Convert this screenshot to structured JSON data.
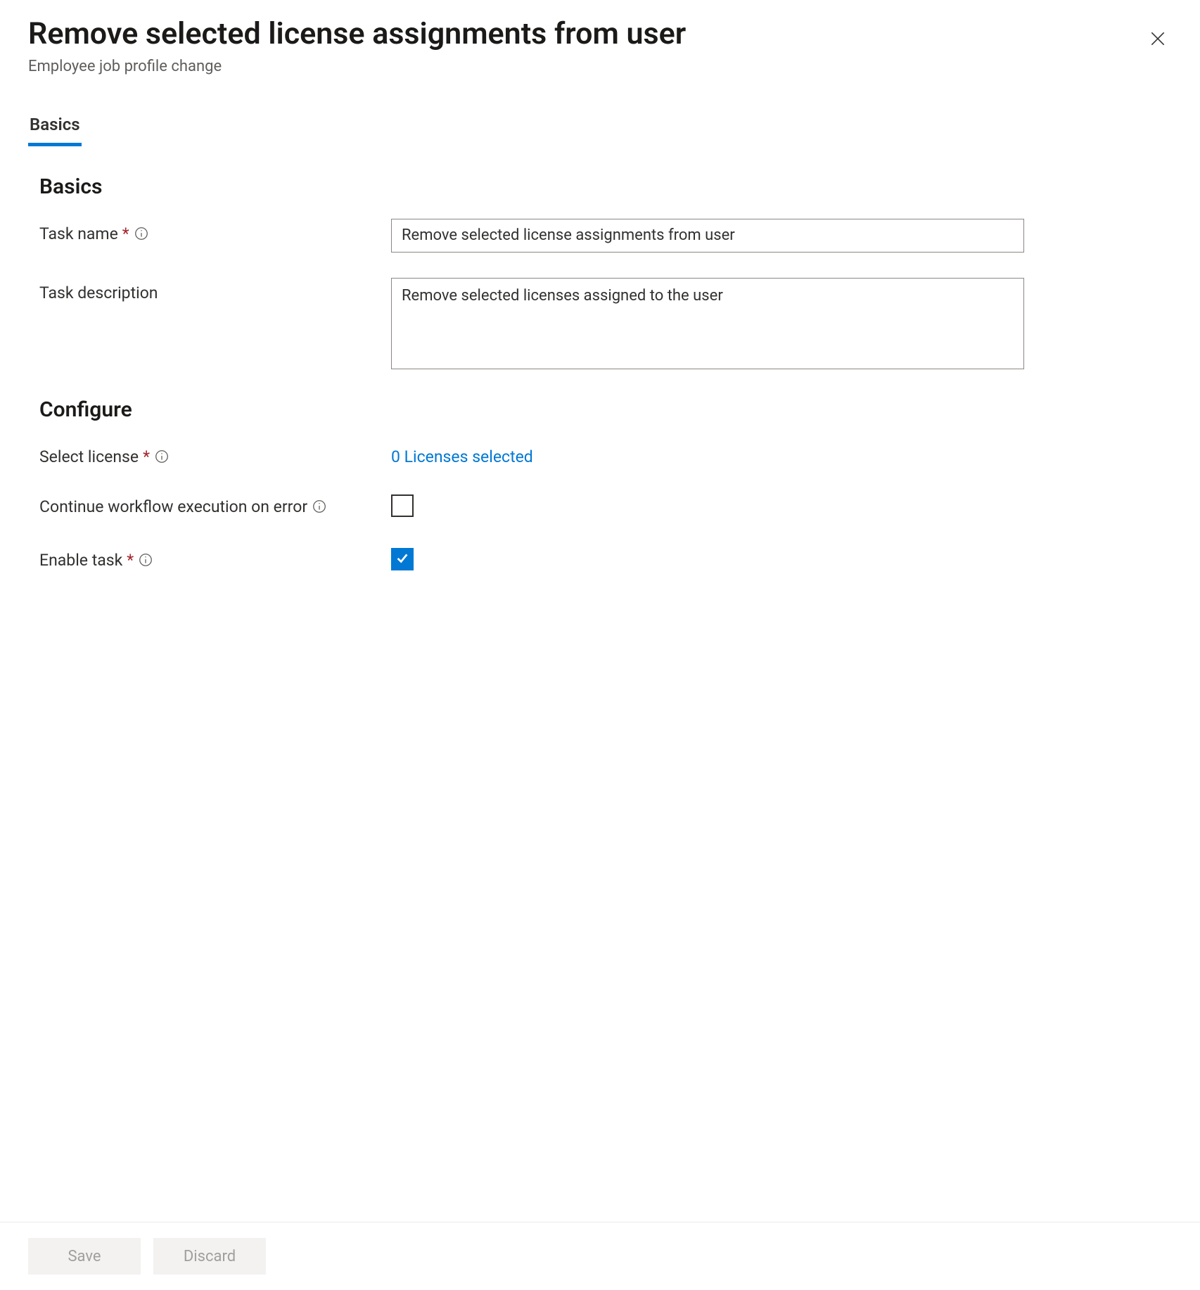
{
  "header": {
    "title": "Remove selected license assignments from user",
    "subtitle": "Employee job profile change"
  },
  "tabs": {
    "basics": "Basics"
  },
  "sections": {
    "basics_heading": "Basics",
    "configure_heading": "Configure"
  },
  "fields": {
    "task_name": {
      "label": "Task name",
      "value": "Remove selected license assignments from user"
    },
    "task_description": {
      "label": "Task description",
      "value": "Remove selected licenses assigned to the user"
    },
    "select_license": {
      "label": "Select license",
      "value_text": "0 Licenses selected"
    },
    "continue_on_error": {
      "label": "Continue workflow execution on error",
      "checked": false
    },
    "enable_task": {
      "label": "Enable task",
      "checked": true
    }
  },
  "footer": {
    "save": "Save",
    "discard": "Discard"
  }
}
